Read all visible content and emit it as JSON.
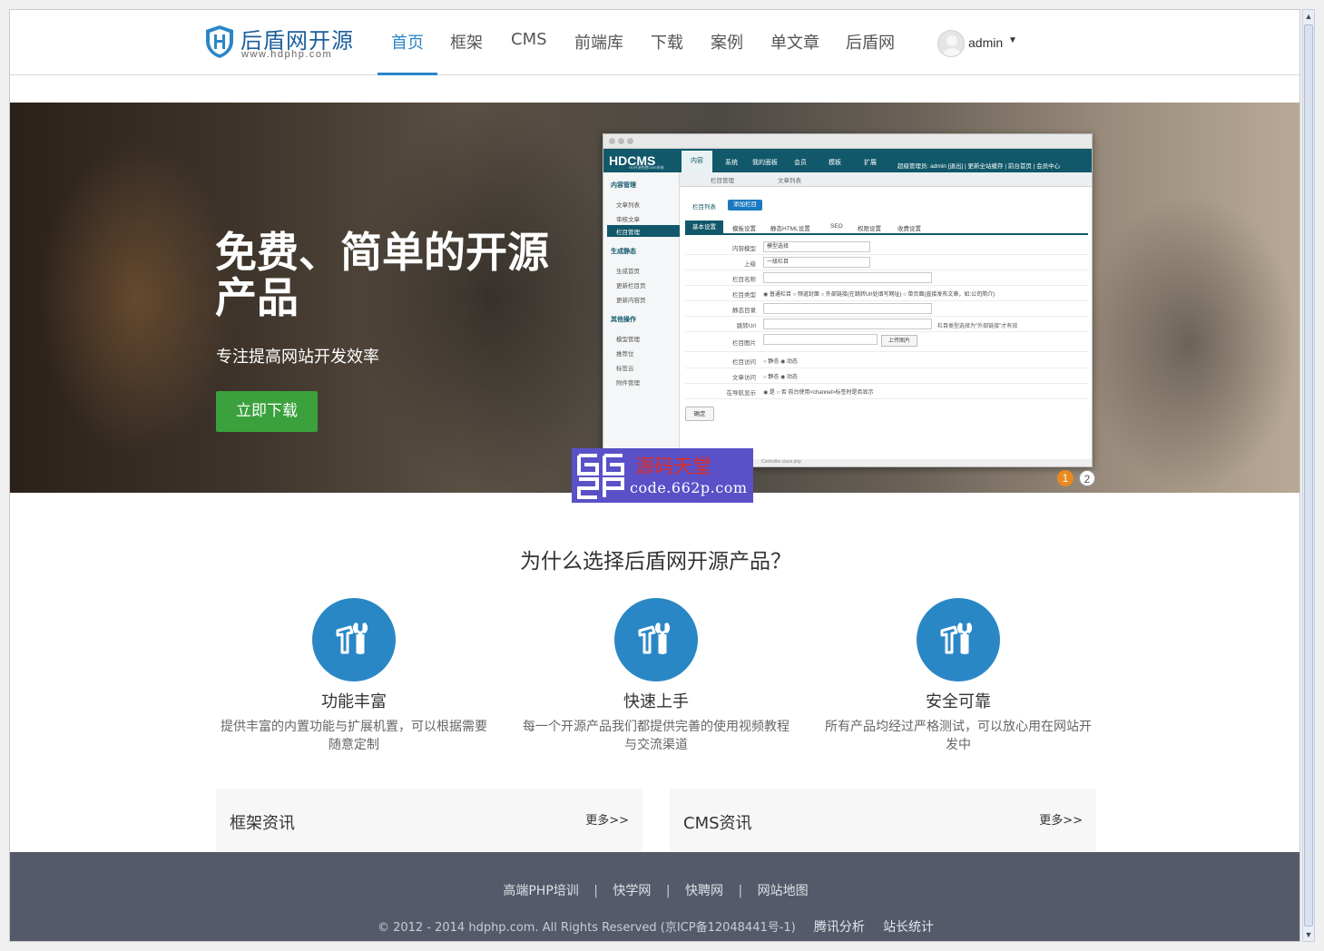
{
  "header": {
    "logo_title": "后盾网开源",
    "logo_sub": "www.hdphp.com",
    "nav": [
      "首页",
      "框架",
      "CMS",
      "前端库",
      "下载",
      "案例",
      "单文章",
      "后盾网"
    ],
    "user": "admin"
  },
  "hero": {
    "title": "免费、简单的开源产品",
    "subtitle": "专注提高网站开发效率",
    "download_label": "立即下载",
    "slides": [
      "1",
      "2"
    ],
    "mock": {
      "logo": "HDCMS",
      "logo_sub": "HD开源免费CMS系统",
      "top_tabs": [
        "内容",
        "系统",
        "我的面板",
        "会员",
        "模板",
        "扩展"
      ],
      "userinfo": "超级管理员: admin [退出] | 更新全站缓存 | 前台首页 | 会员中心",
      "sidebar_groups": [
        "内容管理",
        "生成静态",
        "其他操作"
      ],
      "sidebar_items_1": [
        "文章列表",
        "审核文章",
        "栏目管理"
      ],
      "sidebar_items_2": [
        "生成首页",
        "更新栏目页",
        "更新内容页"
      ],
      "sidebar_items_3": [
        "模型管理",
        "推荐位",
        "标签云",
        "附件管理"
      ],
      "doc_tabs": [
        "栏目管理",
        "文章列表"
      ],
      "list_btn": "栏目列表",
      "add_btn": "添加栏目",
      "set_tabs": [
        "基本设置",
        "模板设置",
        "静态HTML设置",
        "SEO",
        "权限设置",
        "收费设置"
      ],
      "rows": [
        {
          "label": "内容模型",
          "value": "模型选择"
        },
        {
          "label": "上级",
          "value": "一级栏目"
        },
        {
          "label": "栏目名称",
          "value": ""
        },
        {
          "label": "栏目类型",
          "value": "◉ 普通栏目 ○ 频道封面 ○ 外部链接(在跳转Url处填写网址) ○ 单页面(直接发布文章，如:公司简介)"
        },
        {
          "label": "静态目录",
          "value": ""
        },
        {
          "label": "跳转Url",
          "value": ""
        },
        {
          "label": "栏目图片",
          "value": ""
        },
        {
          "label": "栏目访问",
          "value": "○ 静态 ◉ 动态"
        },
        {
          "label": "文章访问",
          "value": "○ 静态 ◉ 动态"
        },
        {
          "label": "在导航显示",
          "value": "◉ 是 ○ 否  前台使用<channel>标签时是否显示"
        }
      ],
      "url_hint": "栏目类型选择为\"外部链接\"才有效",
      "upload_btn": "上传图片",
      "ok_btn": "确定",
      "status": "Controller.class.php"
    }
  },
  "watermark": {
    "title": "源码天堂",
    "url": "code.662p.com"
  },
  "why": {
    "title": "为什么选择后盾网开源产品？",
    "features": [
      {
        "title": "功能丰富",
        "desc": "提供丰富的内置功能与扩展机置，可以根据需要随意定制"
      },
      {
        "title": "快速上手",
        "desc": "每一个开源产品我们都提供完善的使用视频教程与交流渠道"
      },
      {
        "title": "安全可靠",
        "desc": "所有产品均经过严格测试，可以放心用在网站开发中"
      }
    ]
  },
  "news": [
    {
      "title": "框架资讯",
      "more": "更多>>"
    },
    {
      "title": "CMS资讯",
      "more": "更多>>"
    }
  ],
  "footer": {
    "links": [
      "高端PHP培训",
      "快学网",
      "快聘网",
      "网站地图"
    ],
    "copyright": "© 2012 - 2014 hdphp.com. All Rights Reserved (京ICP备12048441号-1)",
    "stats": [
      "腾讯分析",
      "站长统计"
    ]
  },
  "colors": {
    "brand_blue": "#2a86c9",
    "download_green": "#3aa13c",
    "footer_bg": "#555a6a",
    "mock_teal": "#11586a"
  }
}
